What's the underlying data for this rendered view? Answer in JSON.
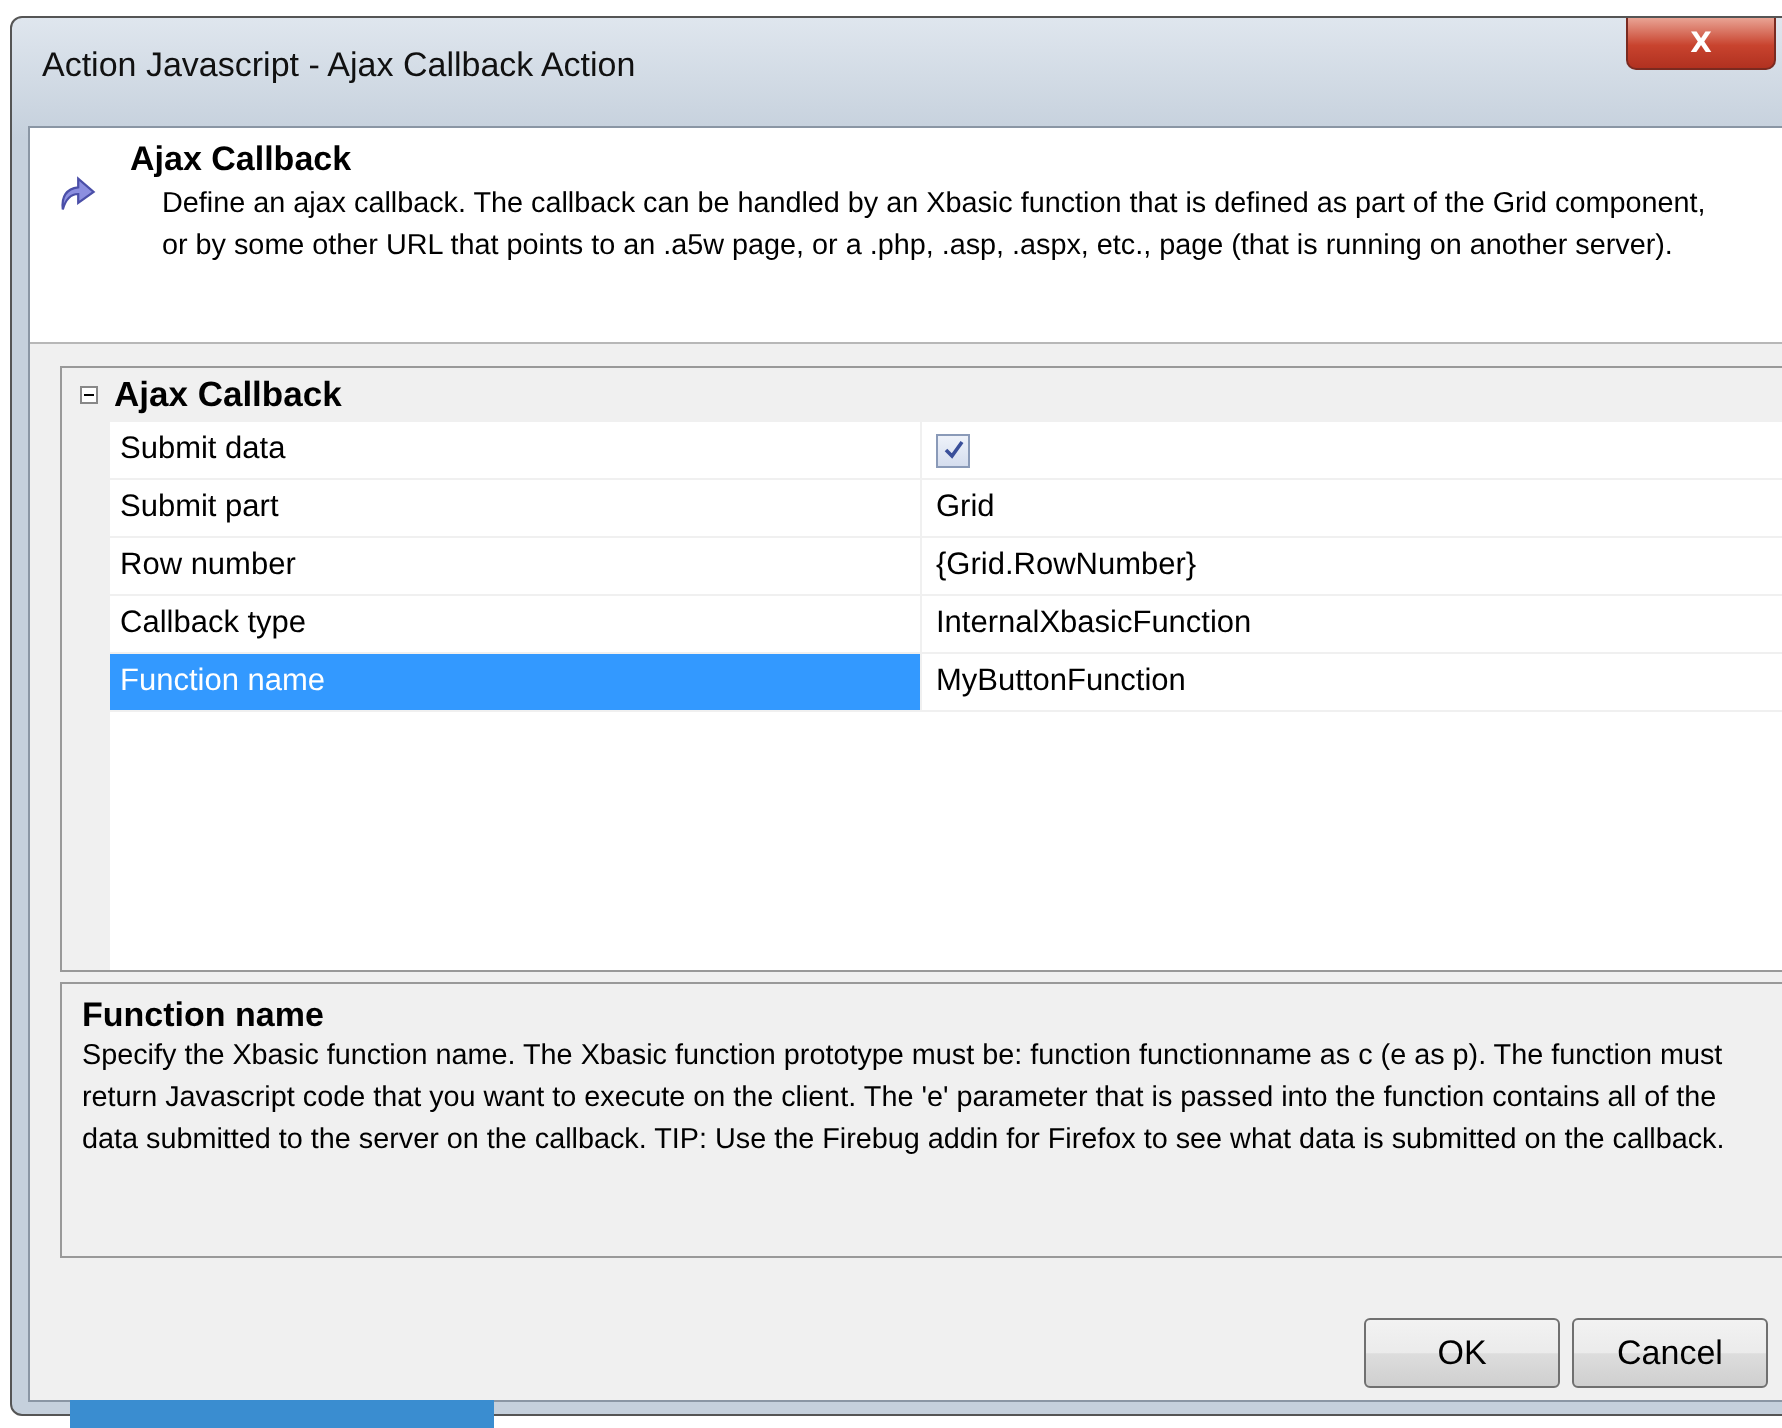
{
  "window": {
    "title": "Action Javascript - Ajax Callback Action",
    "close": "X"
  },
  "header": {
    "title": "Ajax Callback",
    "description": "Define an ajax callback. The callback can be handled by an Xbasic function that is defined as part of the Grid component, or by some other URL that points to an .a5w page, or a .php, .asp, .aspx, etc., page (that is running on another server)."
  },
  "property_grid": {
    "category": {
      "label": "Ajax Callback",
      "expanded": true
    },
    "rows": [
      {
        "name": "Submit data",
        "kind": "checkbox",
        "checked": true,
        "selected": false
      },
      {
        "name": "Submit part",
        "kind": "text",
        "value": "Grid",
        "selected": false
      },
      {
        "name": "Row number",
        "kind": "text",
        "value": "{Grid.RowNumber}",
        "selected": false
      },
      {
        "name": "Callback type",
        "kind": "text",
        "value": "InternalXbasicFunction",
        "selected": false
      },
      {
        "name": "Function name",
        "kind": "text",
        "value": "MyButtonFunction",
        "selected": true
      }
    ]
  },
  "help": {
    "title": "Function name",
    "text": "Specify the Xbasic function name. The Xbasic function prototype must be: function functionname as c (e as p). The function must return Javascript code that you want to execute on the client. The 'e' parameter that is passed into the function contains all of the data submitted to the server on the callback. TIP: Use the Firebug addin for Firefox to see what data is submitted on the callback."
  },
  "buttons": [
    "OK",
    "Cancel"
  ]
}
